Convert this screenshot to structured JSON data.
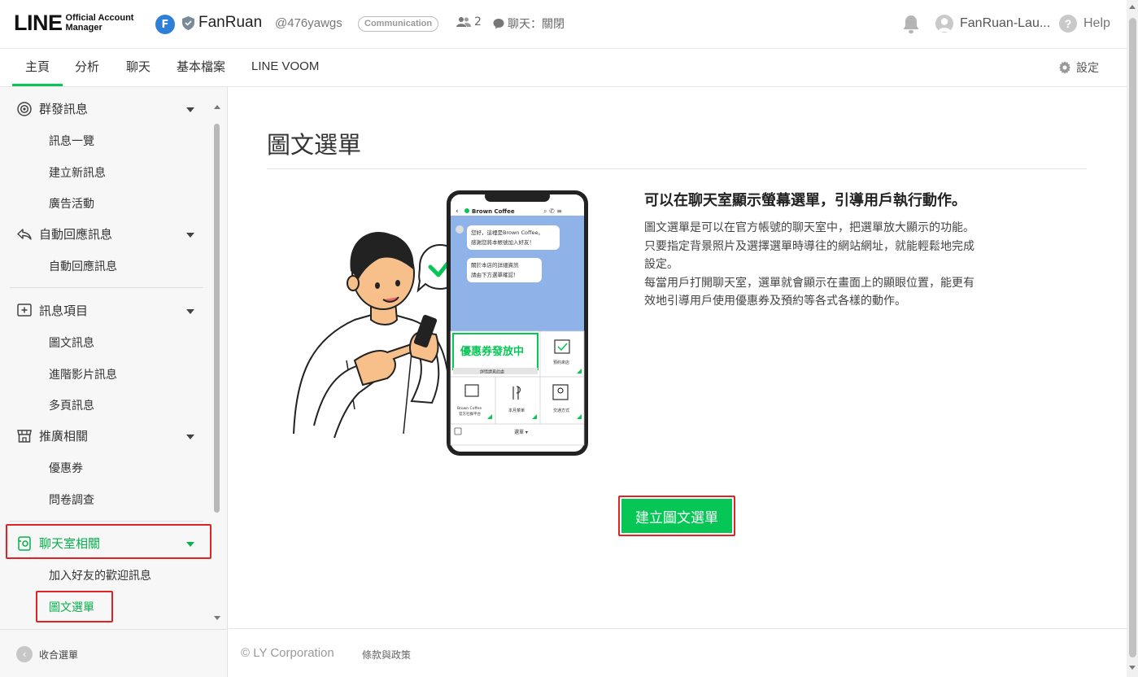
{
  "header": {
    "logo_text": "LINE",
    "logo_sub_line1": "Official Account",
    "logo_sub_line2": "Manager",
    "account_name": "FanRuan",
    "account_id": "@476yawgs",
    "category_badge": "Communication",
    "friends_count": "2",
    "chat_status": "聊天：關閉",
    "user_name": "FanRuan-Lau...",
    "help_label": "Help"
  },
  "tabs": [
    {
      "label": "主頁",
      "active": true
    },
    {
      "label": "分析",
      "active": false
    },
    {
      "label": "聊天",
      "active": false
    },
    {
      "label": "基本檔案",
      "active": false
    },
    {
      "label": "LINE VOOM",
      "active": false
    }
  ],
  "settings_label": "設定",
  "sidebar": {
    "sections": [
      {
        "label": "群發訊息",
        "icon": "broadcast-icon",
        "items": [
          "訊息一覽",
          "建立新訊息",
          "廣告活動"
        ]
      },
      {
        "label": "自動回應訊息",
        "icon": "reply-icon",
        "items": [
          "自動回應訊息"
        ]
      },
      {
        "label": "訊息項目",
        "icon": "add-message-icon",
        "items": [
          "圖文訊息",
          "進階影片訊息",
          "多頁訊息"
        ]
      },
      {
        "label": "推廣相關",
        "icon": "store-icon",
        "items": [
          "優惠券",
          "問卷調查"
        ]
      },
      {
        "label": "聊天室相關",
        "icon": "chat-room-icon",
        "items": [
          "加入好友的歡迎訊息",
          "圖文選單"
        ]
      }
    ],
    "collapse_label": "收合選單"
  },
  "main": {
    "title": "圖文選單",
    "promo_heading": "可以在聊天室顯示螢幕選單，引導用戶執行動作。",
    "promo_body": "圖文選單是可以在官方帳號的聊天室中，把選單放大顯示的功能。\n只要指定背景照片及選擇選單時導往的網站網址，就能輕鬆地完成\n設定。\n每當用戶打開聊天室，選單就會顯示在畫面上的顯眼位置，能更有\n效地引導用戶使用優惠券及預約等各式各樣的動作。",
    "create_button": "建立圖文選單"
  },
  "phone": {
    "chat_name": "Brown Coffee",
    "bubble1_line1": "您好，這裡是Brown Coffee。",
    "bubble1_line2": "感謝您將本帳號加入好友！",
    "bubble2_line1": "關於本店的詳細資訊",
    "bubble2_line2": "請由下方選單確認！",
    "coupon_label": "優惠券發放中",
    "coupon_sub": "詳情請見此處",
    "reserve_label": "預約來店",
    "official_label_1": "Brown Coffee",
    "official_label_2": "官方社群平台",
    "menu_label": "本月菜單",
    "access_label": "交通方式",
    "menu_toggle": "選單 ▾"
  },
  "footer": {
    "copyright": "© LY Corporation",
    "terms": "條款與政策"
  },
  "colors": {
    "accent": "#06c755",
    "highlight_red": "#e02424",
    "phone_chat_bg": "#8fb3e8"
  }
}
